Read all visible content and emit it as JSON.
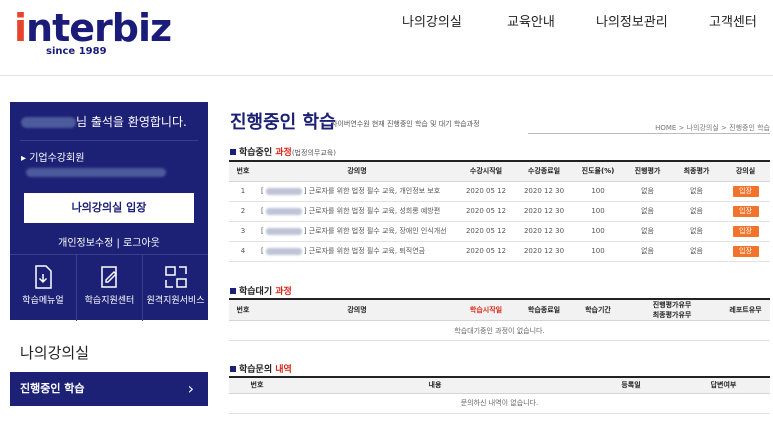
{
  "header": {
    "logo_text": "interbiz",
    "logo_sub": "since 1989",
    "nav": [
      "나의강의실",
      "교육안내",
      "나의정보관리",
      "고객센터"
    ]
  },
  "sidebar": {
    "welcome": "님 출석을 환영합니다.",
    "member_label": "▸ 기업수강회원",
    "enter_button": "나의강의실 입장",
    "links": "개인정보수정  |  로그아웃",
    "icons": [
      {
        "label": "학습메뉴얼",
        "icon": "download-doc-icon"
      },
      {
        "label": "학습지원센터",
        "icon": "edit-doc-icon"
      },
      {
        "label": "원격지원서비스",
        "icon": "remote-screen-icon"
      }
    ],
    "my_title": "나의강의실",
    "my_menu": "진행중인 학습",
    "my_menu_arrow": "›"
  },
  "main": {
    "title": "진행중인 학습",
    "subtitle": "사이버연수원 현재 진행중인 학습 및 대기 학습과정",
    "breadcrumb": "HOME > 나의강의실 > 진행중인 학습",
    "ongoing": {
      "head_a": "학습중인 ",
      "head_b": "과정",
      "head_c": "(법정의무교육)",
      "columns": [
        "번호",
        "강의명",
        "수강시작일",
        "수강종료일",
        "진도율(%)",
        "진행평가",
        "최종평가",
        "강의실"
      ],
      "rows": [
        {
          "no": "1",
          "pre": "[",
          "title": "] 근로자를 위한 법정 필수 교육, 개인정보 보호",
          "start": "2020 05 12",
          "end": "2020 12 30",
          "progress": "100",
          "eval": "없음",
          "final": "없음",
          "room": "입장"
        },
        {
          "no": "2",
          "pre": "[",
          "title": "] 근로자를 위한 법정 필수 교육, 성희롱 예방편",
          "start": "2020 05 12",
          "end": "2020 12 30",
          "progress": "100",
          "eval": "없음",
          "final": "없음",
          "room": "입장"
        },
        {
          "no": "3",
          "pre": "[",
          "title": "] 근로자를 위한 법정 필수 교육, 장애인 인식개선",
          "start": "2020 05 12",
          "end": "2020 12 30",
          "progress": "100",
          "eval": "없음",
          "final": "없음",
          "room": "입장"
        },
        {
          "no": "4",
          "pre": "[",
          "title": "] 근로자를 위한 법정 필수 교육, 퇴직연금",
          "start": "2020 05 12",
          "end": "2020 12 30",
          "progress": "100",
          "eval": "없음",
          "final": "없음",
          "room": "입장"
        }
      ]
    },
    "waiting": {
      "head_a": "학습대기 ",
      "head_b": "과정",
      "columns": [
        "번호",
        "강의명",
        "학습시작일",
        "학습종료일",
        "학습기간",
        "진행평가유무",
        "최종평가유무",
        "레포트유무"
      ],
      "empty": "학습대기중인 과정이 없습니다."
    },
    "inquiry": {
      "head_a": "학습문의 ",
      "head_b": "내역",
      "columns": [
        "번호",
        "내용",
        "등록일",
        "답변여부"
      ],
      "empty": "문의하신 내역이 없습니다."
    }
  }
}
